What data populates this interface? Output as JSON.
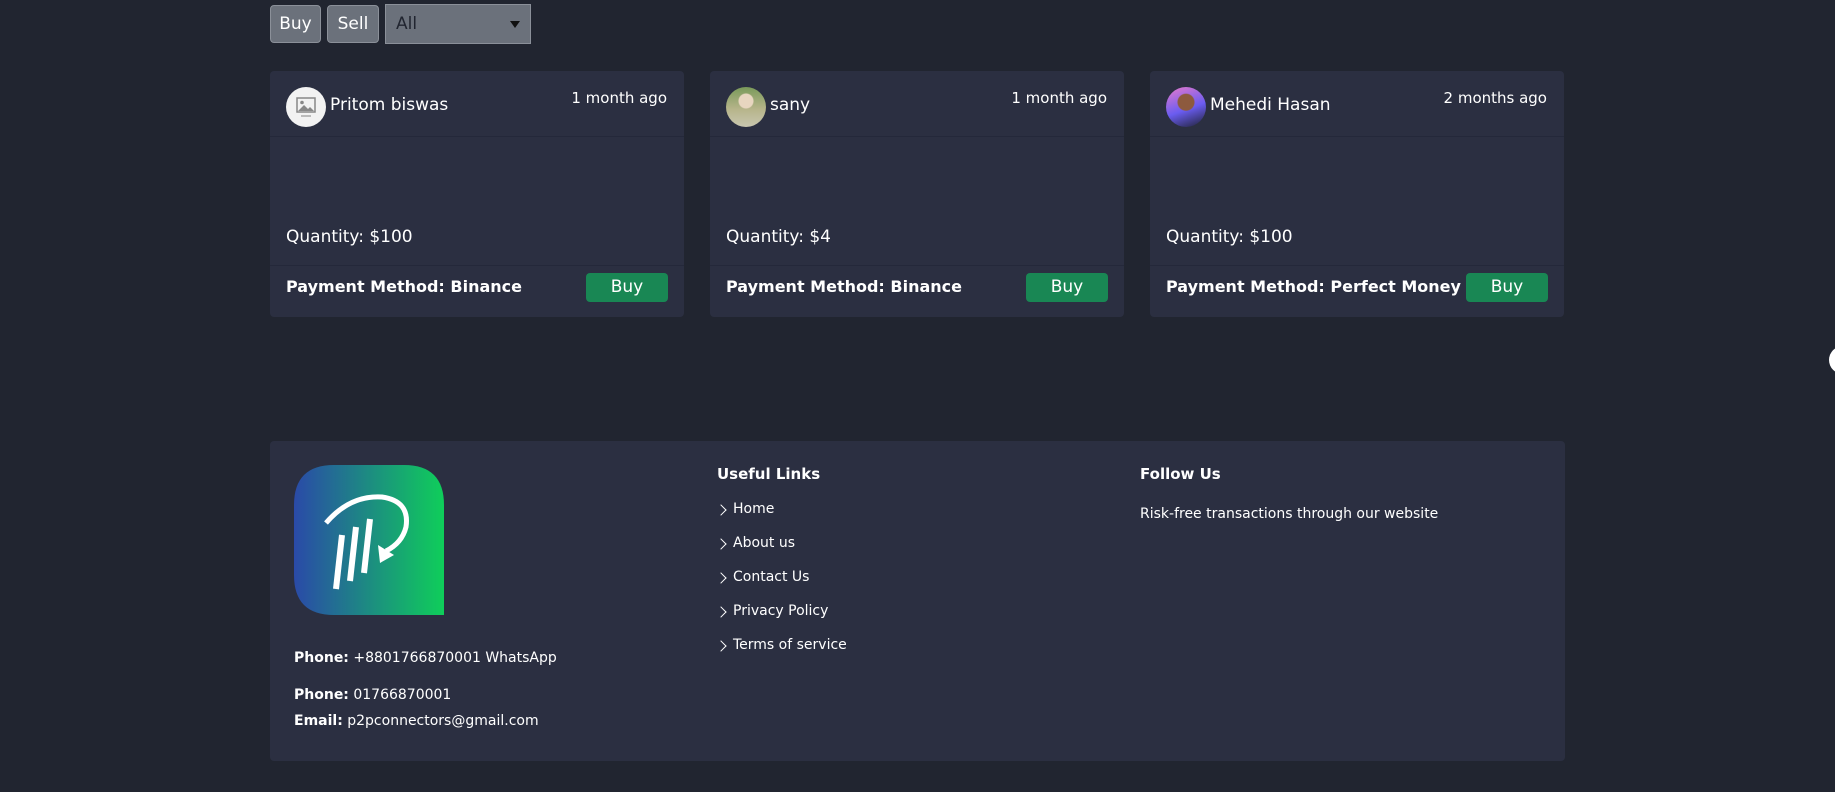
{
  "filters": {
    "buy_label": "Buy",
    "sell_label": "Sell",
    "select_value": "All"
  },
  "offers": [
    {
      "name": "Pritom biswas",
      "time": "1 month ago",
      "quantity": "Quantity: $100",
      "payment_method": "Payment Method: Binance",
      "action_label": "Buy",
      "avatar": "placeholder-image-icon"
    },
    {
      "name": "sany",
      "time": "1 month ago",
      "quantity": "Quantity: $4",
      "payment_method": "Payment Method: Binance",
      "action_label": "Buy",
      "avatar": "user-photo"
    },
    {
      "name": "Mehedi Hasan",
      "time": "2 months ago",
      "quantity": "Quantity: $100",
      "payment_method": "Payment Method: Perfect Money",
      "action_label": "Buy",
      "avatar": "user-photo"
    }
  ],
  "footer": {
    "contact": {
      "phone1_label": "Phone:",
      "phone1_value": "+8801766870001 WhatsApp",
      "phone2_label": "Phone:",
      "phone2_value": "01766870001",
      "email_label": "Email:",
      "email_value": "p2pconnectors@gmail.com"
    },
    "useful_links": {
      "heading": "Useful Links",
      "items": [
        "Home",
        "About us",
        "Contact Us",
        "Privacy Policy",
        "Terms of service"
      ]
    },
    "follow_us": {
      "heading": "Follow Us",
      "text": "Risk-free transactions through our website"
    }
  },
  "colors": {
    "page_bg": "#212530",
    "card_bg": "#2b2f41",
    "buy_button": "#198754",
    "filter_button": "#6b717b",
    "logo_gradient_start": "#2a4aa8",
    "logo_gradient_end": "#0fce5a"
  }
}
